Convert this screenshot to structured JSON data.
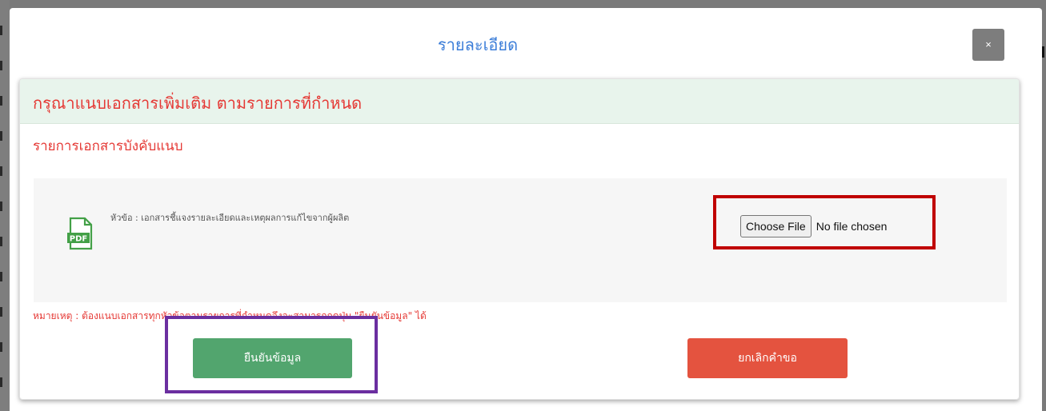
{
  "modal": {
    "title": "รายละเอียด",
    "close_label": "×"
  },
  "panel": {
    "header": "กรุณาแนบเอกสารเพิ่มเติม ตามรายการที่กำหนด",
    "section_title": "รายการเอกสารบังคับแนบ",
    "document": {
      "icon": "pdf-icon",
      "label": "หัวข้อ : เอกสารชี้แจงรายละเอียดและเหตุผลการแก้ไขจากผู้ผลิต",
      "file_button": "Choose File",
      "file_status": "No file chosen"
    },
    "note": "หมายเหตุ : ต้องแนบเอกสารทุกหัวข้อตามรายการที่กำหนดจึงจะสามารถกดปุ่ม \"ยืนยันข้อมูล\" ได้",
    "confirm_button": "ยืนยันข้อมูล",
    "cancel_button": "ยกเลิกคำขอ"
  },
  "colors": {
    "title": "#3b7dd8",
    "header_bg": "#e8f4ec",
    "red_text": "#e53935",
    "confirm": "#52a56e",
    "cancel": "#e4533f",
    "highlight_file": "#c00000",
    "highlight_confirm": "#6b2fa0"
  }
}
